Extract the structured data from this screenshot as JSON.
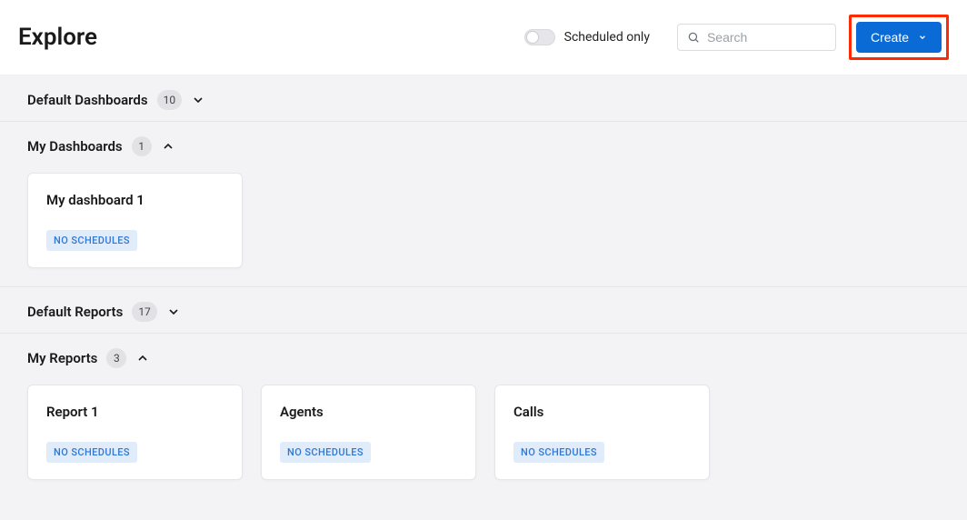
{
  "header": {
    "title": "Explore",
    "scheduled_only_label": "Scheduled only",
    "search_placeholder": "Search",
    "create_label": "Create"
  },
  "sections": {
    "default_dashboards": {
      "title": "Default Dashboards",
      "count": "10"
    },
    "my_dashboards": {
      "title": "My Dashboards",
      "count": "1"
    },
    "default_reports": {
      "title": "Default Reports",
      "count": "17"
    },
    "my_reports": {
      "title": "My Reports",
      "count": "3"
    }
  },
  "my_dashboards_cards": [
    {
      "title": "My dashboard 1",
      "tag": "NO SCHEDULES"
    }
  ],
  "my_reports_cards": [
    {
      "title": "Report 1",
      "tag": "NO SCHEDULES"
    },
    {
      "title": "Agents",
      "tag": "NO SCHEDULES"
    },
    {
      "title": "Calls",
      "tag": "NO SCHEDULES"
    }
  ]
}
